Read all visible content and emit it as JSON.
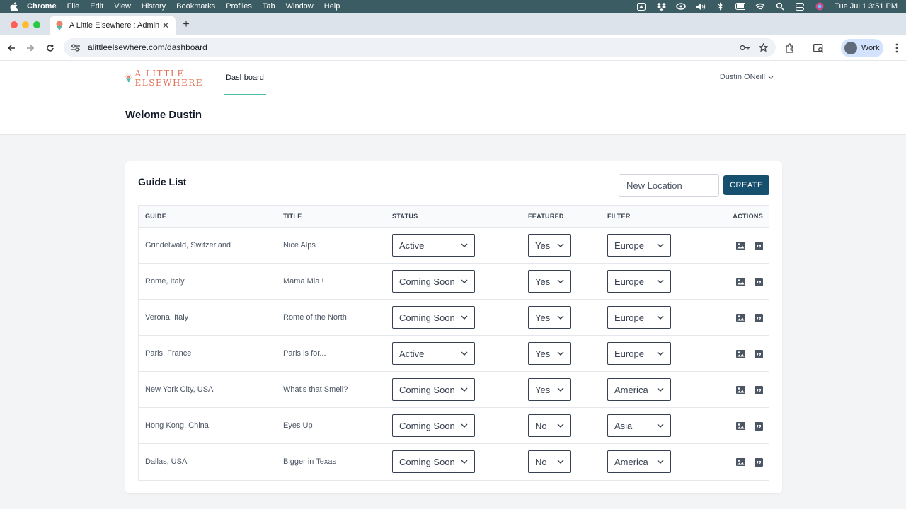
{
  "menubar": {
    "app": "Chrome",
    "items": [
      "File",
      "Edit",
      "View",
      "History",
      "Bookmarks",
      "Profiles",
      "Tab",
      "Window",
      "Help"
    ],
    "clock": "Tue Jul 1  3:51 PM"
  },
  "browser": {
    "tab_title": "A Little Elsewhere : Admin",
    "url": "alittleelsewhere.com/dashboard",
    "profile_label": "Work"
  },
  "app": {
    "logo_line1": "A LITTLE",
    "logo_line2": "ELSEWHERE",
    "nav_tab": "Dashboard",
    "user_name": "Dustin ONeill",
    "welcome": "Welome Dustin",
    "accent": "#4fb8a8",
    "button_color": "#17506e"
  },
  "guide_list": {
    "title": "Guide List",
    "new_location_placeholder": "New Location",
    "create_label": "CREATE",
    "columns": [
      "GUIDE",
      "TITLE",
      "STATUS",
      "FEATURED",
      "FILTER",
      "ACTIONS"
    ],
    "rows": [
      {
        "guide": "Grindelwald, Switzerland",
        "title": "Nice Alps",
        "status": "Active",
        "featured": "Yes",
        "filter": "Europe"
      },
      {
        "guide": "Rome, Italy",
        "title": "Mama Mia !",
        "status": "Coming Soon",
        "featured": "Yes",
        "filter": "Europe"
      },
      {
        "guide": "Verona, Italy",
        "title": "Rome of the North",
        "status": "Coming Soon",
        "featured": "Yes",
        "filter": "Europe"
      },
      {
        "guide": "Paris, France",
        "title": "Paris is for...",
        "status": "Active",
        "featured": "Yes",
        "filter": "Europe"
      },
      {
        "guide": "New York City, USA",
        "title": "What's that Smell?",
        "status": "Coming Soon",
        "featured": "Yes",
        "filter": "America"
      },
      {
        "guide": "Hong Kong, China",
        "title": "Eyes Up",
        "status": "Coming Soon",
        "featured": "No",
        "filter": "Asia"
      },
      {
        "guide": "Dallas, USA",
        "title": "Bigger in Texas",
        "status": "Coming Soon",
        "featured": "No",
        "filter": "America"
      }
    ],
    "action_icons": [
      "image-icon",
      "quote-icon"
    ]
  }
}
